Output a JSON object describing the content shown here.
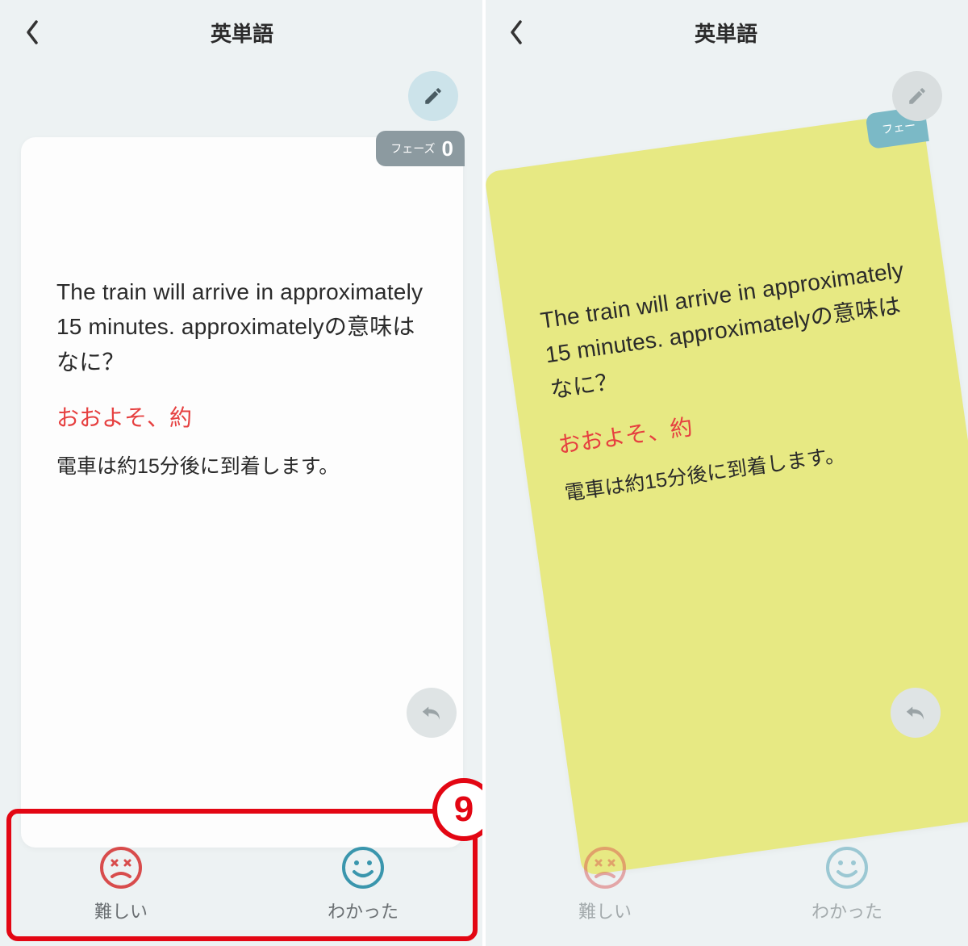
{
  "left": {
    "title": "英単語",
    "phase": {
      "label": "フェーズ",
      "value": "0"
    },
    "card": {
      "question": "The train will arrive in approximately 15 minutes. approximatelyの意味はなに？",
      "answer": "おおよそ、約",
      "translation": "電車は約15分後に到着します。"
    },
    "actions": {
      "hard": "難しい",
      "gotit": "わかった"
    },
    "callout": "9"
  },
  "right": {
    "title": "英単語",
    "phase": {
      "label": "フェー"
    },
    "card": {
      "question": "The train will arrive in approximately 15 minutes. approximatelyの意味はなに？",
      "answer": "おおよそ、約",
      "translation": "電車は約15分後に到着します。"
    },
    "actions": {
      "hard": "難しい",
      "gotit": "わかった"
    }
  }
}
